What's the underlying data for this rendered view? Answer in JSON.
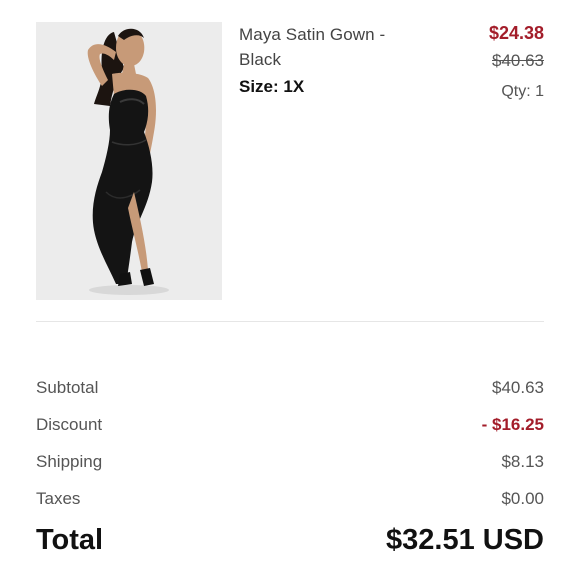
{
  "item": {
    "image_alt": "woman-in-black-satin-gown",
    "name": "Maya Satin Gown - Black",
    "size": "Size: 1X",
    "sale_price": "$24.38",
    "original_price": "$40.63",
    "quantity": "Qty: 1"
  },
  "summary": {
    "rows": [
      {
        "label": "Subtotal",
        "value": "$40.63"
      },
      {
        "label": "Discount",
        "value": "- $16.25"
      },
      {
        "label": "Shipping",
        "value": "$8.13"
      },
      {
        "label": "Taxes",
        "value": "$0.00"
      }
    ],
    "total_label": "Total",
    "total_value": "$32.51 USD"
  },
  "colors": {
    "sale_red": "#a31d2a",
    "text": "#222222",
    "muted": "#555555"
  }
}
